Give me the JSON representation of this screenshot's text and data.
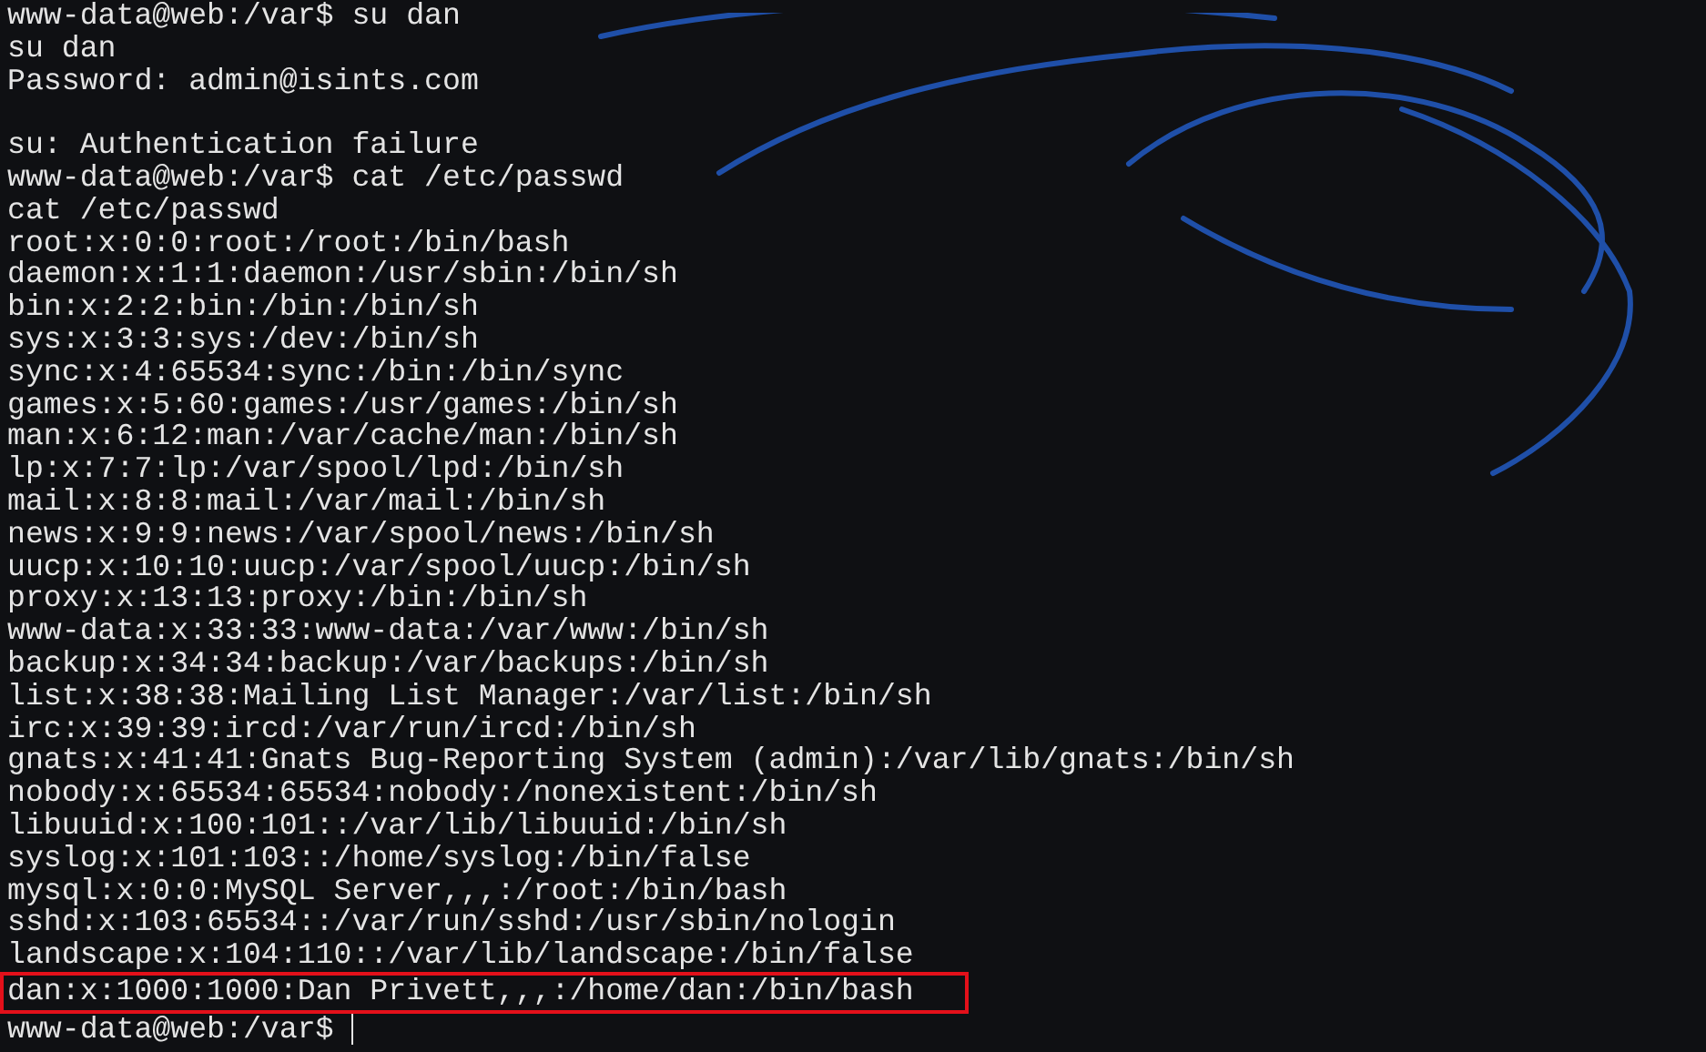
{
  "terminal": {
    "cursor": true,
    "lines": [
      {
        "kind": "text",
        "text": "www-data@web:/var$ su dan"
      },
      {
        "kind": "text",
        "text": "su dan"
      },
      {
        "kind": "text",
        "text": "Password: admin@isints.com"
      },
      {
        "kind": "blank"
      },
      {
        "kind": "text",
        "text": "su: Authentication failure"
      },
      {
        "kind": "text",
        "text": "www-data@web:/var$ cat /etc/passwd"
      },
      {
        "kind": "text",
        "text": "cat /etc/passwd"
      },
      {
        "kind": "text",
        "text": "root:x:0:0:root:/root:/bin/bash"
      },
      {
        "kind": "text",
        "text": "daemon:x:1:1:daemon:/usr/sbin:/bin/sh"
      },
      {
        "kind": "text",
        "text": "bin:x:2:2:bin:/bin:/bin/sh"
      },
      {
        "kind": "text",
        "text": "sys:x:3:3:sys:/dev:/bin/sh"
      },
      {
        "kind": "text",
        "text": "sync:x:4:65534:sync:/bin:/bin/sync"
      },
      {
        "kind": "text",
        "text": "games:x:5:60:games:/usr/games:/bin/sh"
      },
      {
        "kind": "text",
        "text": "man:x:6:12:man:/var/cache/man:/bin/sh"
      },
      {
        "kind": "text",
        "text": "lp:x:7:7:lp:/var/spool/lpd:/bin/sh"
      },
      {
        "kind": "text",
        "text": "mail:x:8:8:mail:/var/mail:/bin/sh"
      },
      {
        "kind": "text",
        "text": "news:x:9:9:news:/var/spool/news:/bin/sh"
      },
      {
        "kind": "text",
        "text": "uucp:x:10:10:uucp:/var/spool/uucp:/bin/sh"
      },
      {
        "kind": "text",
        "text": "proxy:x:13:13:proxy:/bin:/bin/sh"
      },
      {
        "kind": "text",
        "text": "www-data:x:33:33:www-data:/var/www:/bin/sh"
      },
      {
        "kind": "text",
        "text": "backup:x:34:34:backup:/var/backups:/bin/sh"
      },
      {
        "kind": "text",
        "text": "list:x:38:38:Mailing List Manager:/var/list:/bin/sh"
      },
      {
        "kind": "text",
        "text": "irc:x:39:39:ircd:/var/run/ircd:/bin/sh"
      },
      {
        "kind": "text",
        "text": "gnats:x:41:41:Gnats Bug-Reporting System (admin):/var/lib/gnats:/bin/sh"
      },
      {
        "kind": "text",
        "text": "nobody:x:65534:65534:nobody:/nonexistent:/bin/sh"
      },
      {
        "kind": "text",
        "text": "libuuid:x:100:101::/var/lib/libuuid:/bin/sh"
      },
      {
        "kind": "text",
        "text": "syslog:x:101:103::/home/syslog:/bin/false"
      },
      {
        "kind": "text",
        "text": "mysql:x:0:0:MySQL Server,,,:/root:/bin/bash"
      },
      {
        "kind": "text",
        "text": "sshd:x:103:65534::/var/run/sshd:/usr/sbin/nologin"
      },
      {
        "kind": "text",
        "text": "landscape:x:104:110::/var/lib/landscape:/bin/false"
      },
      {
        "kind": "highlighted",
        "text": "dan:x:1000:1000:Dan Privett,,,:/home/dan:/bin/bash"
      },
      {
        "kind": "text",
        "text": "www-data@web:/var$ "
      }
    ]
  }
}
